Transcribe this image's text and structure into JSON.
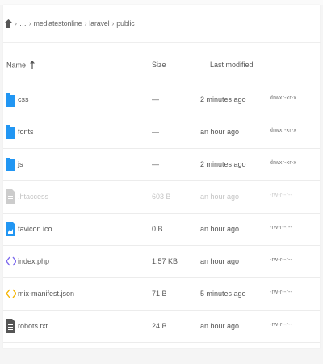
{
  "breadcrumb": {
    "items": [
      "…",
      "mediatestonline",
      "laravel",
      "public"
    ],
    "separator": "›"
  },
  "table": {
    "headers": {
      "name": "Name",
      "size": "Size",
      "modified": "Last modified"
    },
    "rows": [
      {
        "name": "css",
        "size": "—",
        "modified": "2 minutes ago",
        "perms": "drwxr-xr-x",
        "icon": "folder-icon",
        "faded": false
      },
      {
        "name": "fonts",
        "size": "—",
        "modified": "an hour ago",
        "perms": "drwxr-xr-x",
        "icon": "folder-icon",
        "faded": false
      },
      {
        "name": "js",
        "size": "—",
        "modified": "2 minutes ago",
        "perms": "drwxr-xr-x",
        "icon": "folder-icon",
        "faded": false
      },
      {
        "name": ".htaccess",
        "size": "603 B",
        "modified": "an hour ago",
        "perms": "-rw-r--r--",
        "icon": "file-icon",
        "faded": true
      },
      {
        "name": "favicon.ico",
        "size": "0 B",
        "modified": "an hour ago",
        "perms": "-rw-r--r--",
        "icon": "image-file-icon",
        "faded": false
      },
      {
        "name": "index.php",
        "size": "1.57 KB",
        "modified": "an hour ago",
        "perms": "-rw-r--r--",
        "icon": "code-icon",
        "faded": false
      },
      {
        "name": "mix-manifest.json",
        "size": "71 B",
        "modified": "5 minutes ago",
        "perms": "-rw-r--r--",
        "icon": "json-icon",
        "faded": false
      },
      {
        "name": "robots.txt",
        "size": "24 B",
        "modified": "an hour ago",
        "perms": "-rw-r--r--",
        "icon": "text-file-icon",
        "faded": false
      }
    ]
  },
  "colors": {
    "folder": "#2196f3",
    "code": "#7b68ee",
    "json": "#f5b400",
    "textfile": "#555555",
    "faded": "#cccccc"
  }
}
